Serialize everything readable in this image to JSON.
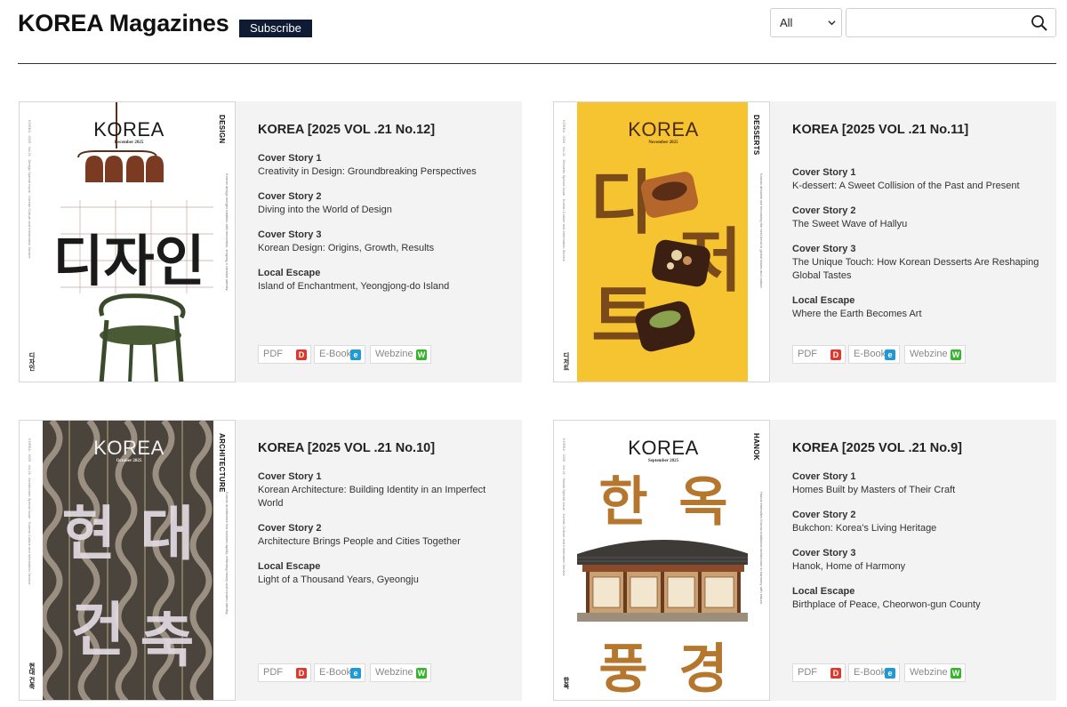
{
  "header": {
    "title": "KOREA Magazines",
    "subscribe_label": "Subscribe",
    "filter_value": "All",
    "search_placeholder": ""
  },
  "colors": {
    "pdf": "#e0362c",
    "ebook": "#1f9ad6",
    "webzine": "#35b529",
    "subscribe_bg": "#0f1b33"
  },
  "issues": [
    {
      "title": "KOREA [2025 VOL .21 No.12]",
      "cover": {
        "logo": "KOREA",
        "month": "December 2025",
        "spine": "DESIGN",
        "spine_korean": "디자인",
        "headline": "디자인"
      },
      "stories": [
        {
          "label": "Cover Story 1",
          "text": "Creativity in Design: Groundbreaking Perspectives"
        },
        {
          "label": "Cover Story 2",
          "text": "Diving into the World of Design"
        },
        {
          "label": "Cover Story 3",
          "text": "Korean Design: Origins, Growth, Results"
        },
        {
          "label": "Local Escape",
          "text": "Island of Enchantment, Yeongjong-do Island"
        }
      ],
      "links": {
        "pdf": "PDF",
        "ebook": "E-Book",
        "webzine": "Webzine"
      }
    },
    {
      "title": "KOREA [2025 VOL .21 No.11]",
      "cover": {
        "logo": "KOREA",
        "month": "November 2025",
        "spine": "DESSERTS",
        "spine_korean": "디저트",
        "headline": "디저트"
      },
      "stories": [
        {
          "label": "Cover Story 1",
          "text": "K-dessert: A Sweet Collision of the Past and Present"
        },
        {
          "label": "Cover Story 2",
          "text": "The Sweet Wave of Hallyu"
        },
        {
          "label": "Cover Story 3",
          "text": "The Unique Touch: How Korean Desserts Are Reshaping Global Tastes"
        },
        {
          "label": "Local Escape",
          "text": "Where the Earth Becomes Art"
        }
      ],
      "links": {
        "pdf": "PDF",
        "ebook": "E-Book",
        "webzine": "Webzine"
      }
    },
    {
      "title": "KOREA [2025 VOL .21 No.10]",
      "cover": {
        "logo": "KOREA",
        "month": "October 2025",
        "spine": "ARCHITECTURE",
        "spine_korean": "현대 건축",
        "headline": "현대건축"
      },
      "stories": [
        {
          "label": "Cover Story 1",
          "text": "Korean Architecture: Building Identity in an Imperfect World"
        },
        {
          "label": "Cover Story 2",
          "text": "Architecture Brings People and Cities Together"
        },
        {
          "label": "Local Escape",
          "text": "Light of a Thousand Years, Gyeongju"
        }
      ],
      "links": {
        "pdf": "PDF",
        "ebook": "E-Book",
        "webzine": "Webzine"
      }
    },
    {
      "title": "KOREA [2025 VOL .21 No.9]",
      "cover": {
        "logo": "KOREA",
        "month": "September 2025",
        "spine": "HANOK",
        "spine_korean": "한옥",
        "headline": "한옥풍경"
      },
      "stories": [
        {
          "label": "Cover Story 1",
          "text": "Homes Built by Masters of Their Craft"
        },
        {
          "label": "Cover Story 2",
          "text": "Bukchon: Korea's Living Heritage"
        },
        {
          "label": "Cover Story 3",
          "text": "Hanok, Home of Harmony"
        },
        {
          "label": "Local Escape",
          "text": "Birthplace of Peace, Cheorwon-gun County"
        }
      ],
      "links": {
        "pdf": "PDF",
        "ebook": "E-Book",
        "webzine": "Webzine"
      }
    }
  ]
}
